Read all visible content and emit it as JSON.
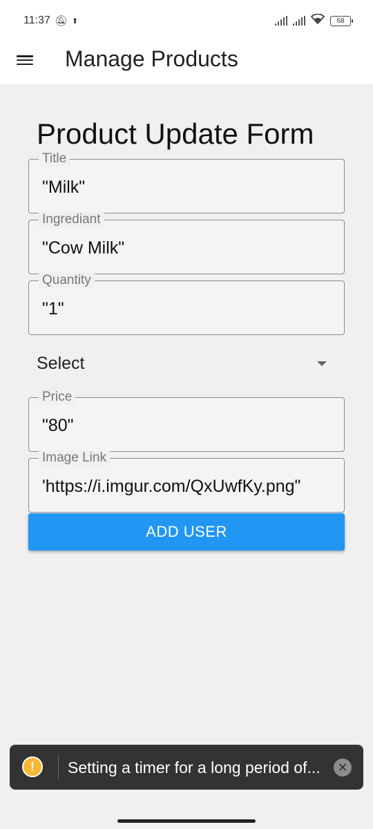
{
  "status_bar": {
    "time": "11:37",
    "battery": "68"
  },
  "app_bar": {
    "title": "Manage Products"
  },
  "form": {
    "title": "Product Update Form",
    "fields": [
      {
        "label": "Title",
        "value": "\"Milk\""
      },
      {
        "label": "Ingrediant",
        "value": "\"Cow Milk\""
      },
      {
        "label": "Quantity",
        "value": "\"1\""
      },
      {
        "label": "Price",
        "value": "\"80\""
      },
      {
        "label": "Image Link",
        "value": "'https://i.imgur.com/QxUwfKy.png\""
      }
    ],
    "select": {
      "value": "Select"
    },
    "submit_label": "ADD USER"
  },
  "toast": {
    "icon": "warning-icon",
    "message": "Setting a timer for a long period of...",
    "close_glyph": "✕"
  },
  "colors": {
    "accent": "#2196f3",
    "toast_bg": "#333333",
    "warning": "#f7b731"
  }
}
